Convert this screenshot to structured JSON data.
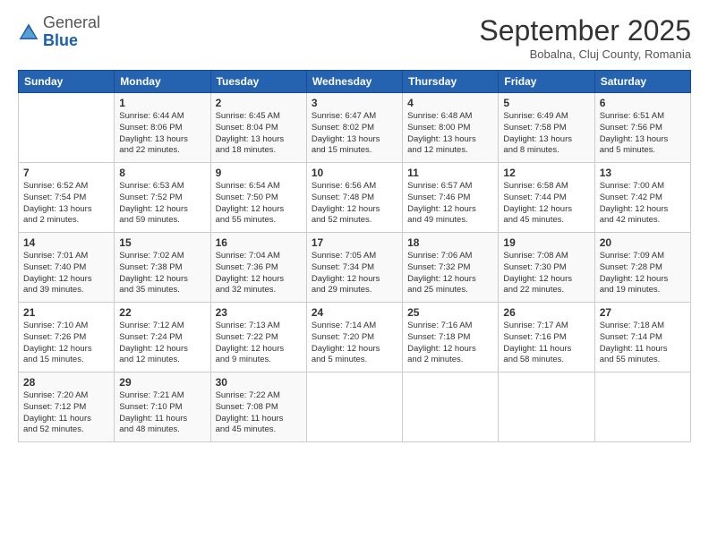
{
  "logo": {
    "general": "General",
    "blue": "Blue"
  },
  "header": {
    "month": "September 2025",
    "location": "Bobalna, Cluj County, Romania"
  },
  "weekdays": [
    "Sunday",
    "Monday",
    "Tuesday",
    "Wednesday",
    "Thursday",
    "Friday",
    "Saturday"
  ],
  "weeks": [
    [
      {
        "day": "",
        "info": ""
      },
      {
        "day": "1",
        "info": "Sunrise: 6:44 AM\nSunset: 8:06 PM\nDaylight: 13 hours\nand 22 minutes."
      },
      {
        "day": "2",
        "info": "Sunrise: 6:45 AM\nSunset: 8:04 PM\nDaylight: 13 hours\nand 18 minutes."
      },
      {
        "day": "3",
        "info": "Sunrise: 6:47 AM\nSunset: 8:02 PM\nDaylight: 13 hours\nand 15 minutes."
      },
      {
        "day": "4",
        "info": "Sunrise: 6:48 AM\nSunset: 8:00 PM\nDaylight: 13 hours\nand 12 minutes."
      },
      {
        "day": "5",
        "info": "Sunrise: 6:49 AM\nSunset: 7:58 PM\nDaylight: 13 hours\nand 8 minutes."
      },
      {
        "day": "6",
        "info": "Sunrise: 6:51 AM\nSunset: 7:56 PM\nDaylight: 13 hours\nand 5 minutes."
      }
    ],
    [
      {
        "day": "7",
        "info": "Sunrise: 6:52 AM\nSunset: 7:54 PM\nDaylight: 13 hours\nand 2 minutes."
      },
      {
        "day": "8",
        "info": "Sunrise: 6:53 AM\nSunset: 7:52 PM\nDaylight: 12 hours\nand 59 minutes."
      },
      {
        "day": "9",
        "info": "Sunrise: 6:54 AM\nSunset: 7:50 PM\nDaylight: 12 hours\nand 55 minutes."
      },
      {
        "day": "10",
        "info": "Sunrise: 6:56 AM\nSunset: 7:48 PM\nDaylight: 12 hours\nand 52 minutes."
      },
      {
        "day": "11",
        "info": "Sunrise: 6:57 AM\nSunset: 7:46 PM\nDaylight: 12 hours\nand 49 minutes."
      },
      {
        "day": "12",
        "info": "Sunrise: 6:58 AM\nSunset: 7:44 PM\nDaylight: 12 hours\nand 45 minutes."
      },
      {
        "day": "13",
        "info": "Sunrise: 7:00 AM\nSunset: 7:42 PM\nDaylight: 12 hours\nand 42 minutes."
      }
    ],
    [
      {
        "day": "14",
        "info": "Sunrise: 7:01 AM\nSunset: 7:40 PM\nDaylight: 12 hours\nand 39 minutes."
      },
      {
        "day": "15",
        "info": "Sunrise: 7:02 AM\nSunset: 7:38 PM\nDaylight: 12 hours\nand 35 minutes."
      },
      {
        "day": "16",
        "info": "Sunrise: 7:04 AM\nSunset: 7:36 PM\nDaylight: 12 hours\nand 32 minutes."
      },
      {
        "day": "17",
        "info": "Sunrise: 7:05 AM\nSunset: 7:34 PM\nDaylight: 12 hours\nand 29 minutes."
      },
      {
        "day": "18",
        "info": "Sunrise: 7:06 AM\nSunset: 7:32 PM\nDaylight: 12 hours\nand 25 minutes."
      },
      {
        "day": "19",
        "info": "Sunrise: 7:08 AM\nSunset: 7:30 PM\nDaylight: 12 hours\nand 22 minutes."
      },
      {
        "day": "20",
        "info": "Sunrise: 7:09 AM\nSunset: 7:28 PM\nDaylight: 12 hours\nand 19 minutes."
      }
    ],
    [
      {
        "day": "21",
        "info": "Sunrise: 7:10 AM\nSunset: 7:26 PM\nDaylight: 12 hours\nand 15 minutes."
      },
      {
        "day": "22",
        "info": "Sunrise: 7:12 AM\nSunset: 7:24 PM\nDaylight: 12 hours\nand 12 minutes."
      },
      {
        "day": "23",
        "info": "Sunrise: 7:13 AM\nSunset: 7:22 PM\nDaylight: 12 hours\nand 9 minutes."
      },
      {
        "day": "24",
        "info": "Sunrise: 7:14 AM\nSunset: 7:20 PM\nDaylight: 12 hours\nand 5 minutes."
      },
      {
        "day": "25",
        "info": "Sunrise: 7:16 AM\nSunset: 7:18 PM\nDaylight: 12 hours\nand 2 minutes."
      },
      {
        "day": "26",
        "info": "Sunrise: 7:17 AM\nSunset: 7:16 PM\nDaylight: 11 hours\nand 58 minutes."
      },
      {
        "day": "27",
        "info": "Sunrise: 7:18 AM\nSunset: 7:14 PM\nDaylight: 11 hours\nand 55 minutes."
      }
    ],
    [
      {
        "day": "28",
        "info": "Sunrise: 7:20 AM\nSunset: 7:12 PM\nDaylight: 11 hours\nand 52 minutes."
      },
      {
        "day": "29",
        "info": "Sunrise: 7:21 AM\nSunset: 7:10 PM\nDaylight: 11 hours\nand 48 minutes."
      },
      {
        "day": "30",
        "info": "Sunrise: 7:22 AM\nSunset: 7:08 PM\nDaylight: 11 hours\nand 45 minutes."
      },
      {
        "day": "",
        "info": ""
      },
      {
        "day": "",
        "info": ""
      },
      {
        "day": "",
        "info": ""
      },
      {
        "day": "",
        "info": ""
      }
    ]
  ]
}
